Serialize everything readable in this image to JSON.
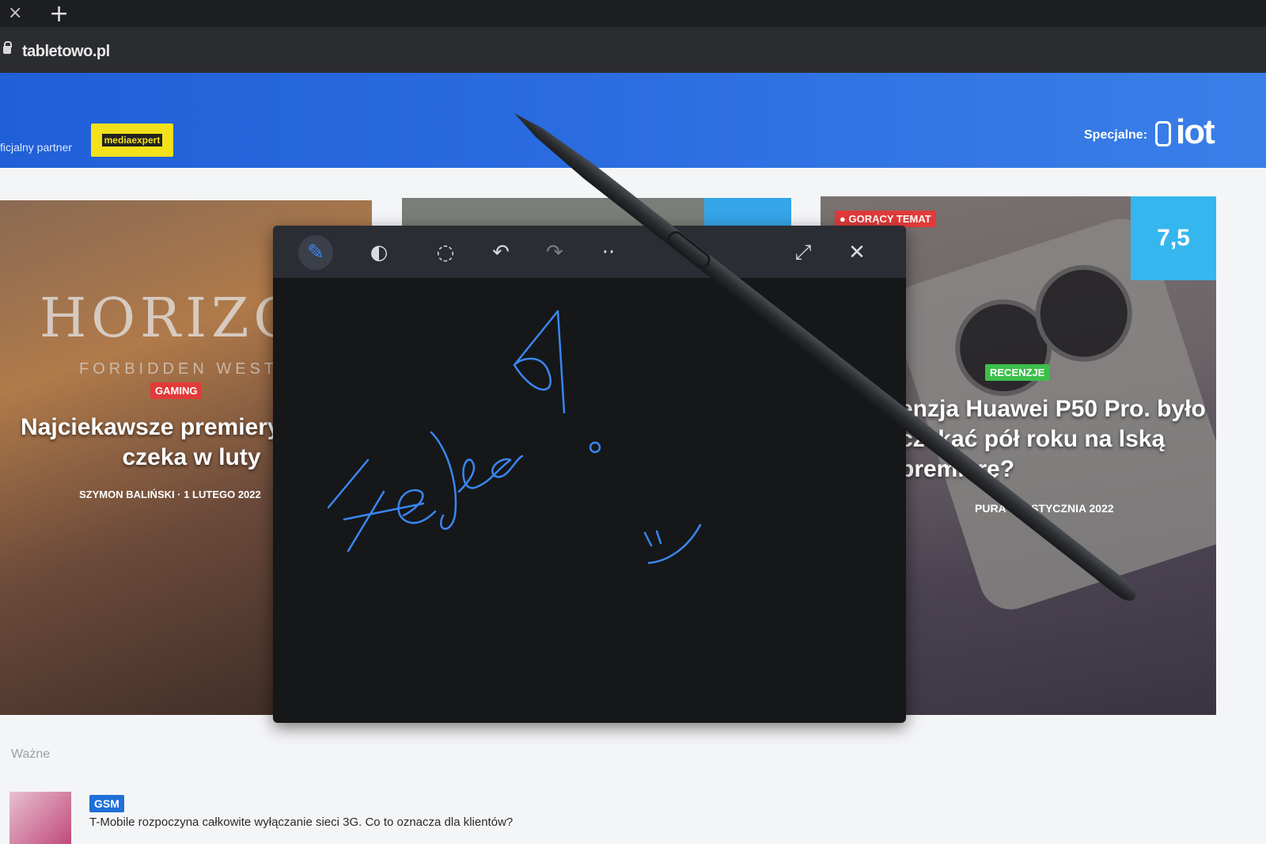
{
  "browser": {
    "tab_close": "×",
    "tab_new": "+",
    "url": "tabletowo.pl"
  },
  "header": {
    "partner_label": "ficjalny partner",
    "partner_logo": "mediaexpert",
    "special_label": "Specjalne:",
    "special_logo": "iot"
  },
  "left_card": {
    "art_title": "HORIZO",
    "art_subtitle": "FORBIDDEN WEST",
    "category": "GAMING",
    "title": "Najciekawsze premiery co nas czeka w luty",
    "author": "SZYMON BALIŃSKI",
    "date": "1 LUTEGO 2022"
  },
  "right_card": {
    "hot_label": "GORĄCY TEMAT",
    "score": "7,5",
    "category": "RECENZJE",
    "title": "enzja Huawei P50 Pro. było czekać pół roku na lską premierę?",
    "author": "PURA",
    "date": "30 STYCZNIA 2022"
  },
  "important": {
    "label": "Ważne",
    "items": [
      {
        "category": "GSM",
        "title": "T-Mobile rozpoczyna całkowite wyłączanie sieci 3G. Co to oznacza dla klientów?"
      }
    ]
  },
  "note_panel": {
    "tools": [
      {
        "name": "pen-tool",
        "glyph": "✎"
      },
      {
        "name": "eraser-tool",
        "glyph": "◐"
      },
      {
        "name": "lasso-tool",
        "glyph": "◌"
      },
      {
        "name": "undo",
        "glyph": "↶"
      },
      {
        "name": "redo",
        "glyph": "↷"
      },
      {
        "name": "more",
        "glyph": "··"
      },
      {
        "name": "expand",
        "glyph": "⤢"
      },
      {
        "name": "close",
        "glyph": "✕"
      }
    ],
    "ink_color": "#3a86f0"
  },
  "colors": {
    "header_blue": "#2a6ce0",
    "badge_red": "#e23a3a",
    "badge_green": "#3cbf4a",
    "score_blue": "#35b6ee",
    "badge_gsm": "#1f6fd8"
  }
}
